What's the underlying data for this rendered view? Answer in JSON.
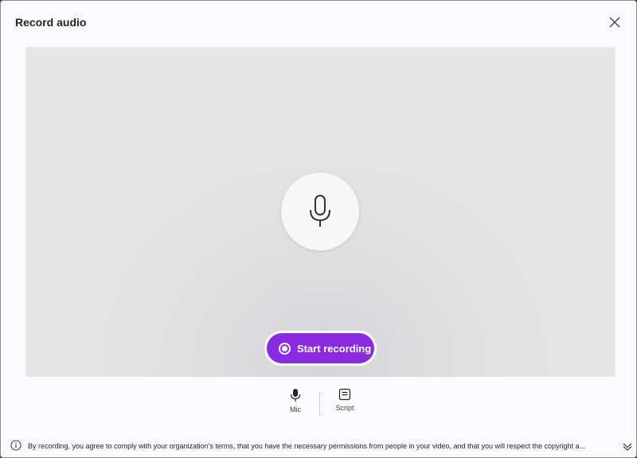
{
  "dialog": {
    "title": "Record audio"
  },
  "stage": {
    "start_button_label": "Start recording"
  },
  "toolbar": {
    "mic_label": "Mic",
    "script_label": "Script"
  },
  "footer": {
    "notice": "By recording, you agree to comply with your organization's terms, that you have the necessary permissions from people in your video, and that you will respect the copyright a..."
  },
  "colors": {
    "accent": "#8a2be2",
    "stage_bg": "#e6e6e6",
    "dialog_bg": "#fbfbfe"
  },
  "icons": [
    "close-icon",
    "microphone-icon",
    "record-icon",
    "script-icon",
    "info-icon",
    "chevron-down-icon"
  ]
}
